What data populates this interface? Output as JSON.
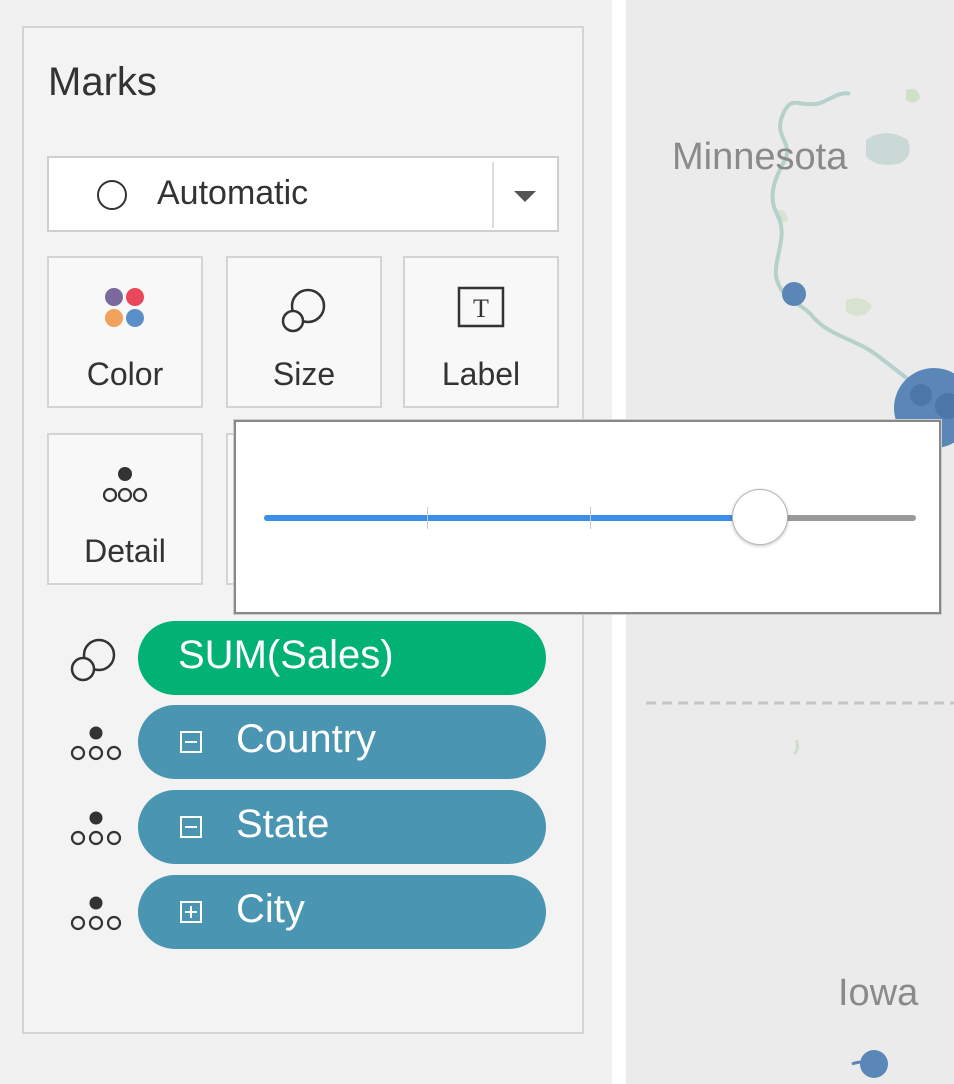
{
  "marks": {
    "title": "Marks",
    "mark_type": {
      "value": "Automatic",
      "icon": "circle-icon"
    },
    "buttons": [
      {
        "label": "Color",
        "icon": "color-dots-icon"
      },
      {
        "label": "Size",
        "icon": "size-icon"
      },
      {
        "label": "Label",
        "icon": "text-label-icon"
      },
      {
        "label": "Detail",
        "icon": "detail-dots-icon"
      }
    ],
    "fields": [
      {
        "label": "SUM(Sales)",
        "shelf_icon": "size-icon",
        "color": "#02b174",
        "box": "none"
      },
      {
        "label": "Country",
        "shelf_icon": "detail-dots-icon",
        "color": "#4995b2",
        "box": "collapse"
      },
      {
        "label": "State",
        "shelf_icon": "detail-dots-icon",
        "color": "#4995b2",
        "box": "collapse"
      },
      {
        "label": "City",
        "shelf_icon": "detail-dots-icon",
        "color": "#4995b2",
        "box": "expand"
      }
    ]
  },
  "size_slider": {
    "value_fraction": 0.76,
    "tick_fractions": [
      0.25,
      0.5
    ],
    "fill_color": "#3b8fe8"
  },
  "map": {
    "labels": [
      "Minnesota",
      "Iowa"
    ],
    "river_color": "#b6d0cb",
    "mark_color": "#5a86b8"
  }
}
